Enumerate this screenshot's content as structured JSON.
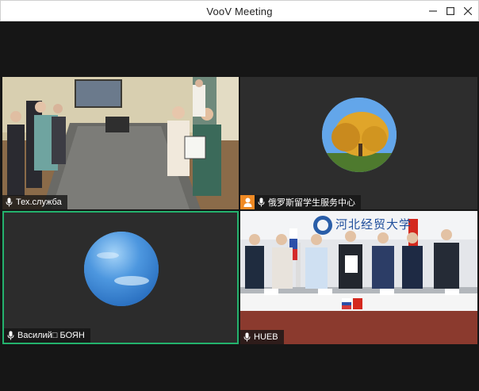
{
  "window": {
    "title": "VooV Meeting",
    "controls": {
      "minimize": "minimize",
      "maximize": "maximize",
      "close": "close"
    }
  },
  "participants": [
    {
      "name": "Тех.служба",
      "video": "camera-on",
      "mic": "mic-icon"
    },
    {
      "name": "俄罗斯留学生服务中心",
      "video": "avatar",
      "badge": "host-icon",
      "badge_color": "#f08a24"
    },
    {
      "name": "Василий□ БОЯН",
      "video": "avatar",
      "mic": "mic-icon",
      "active_speaker": true,
      "highlight_color": "#23b26d"
    },
    {
      "name": "HUEB",
      "video": "camera-on",
      "mic": "mic-icon"
    }
  ],
  "room_sign": "河北经贸大学"
}
